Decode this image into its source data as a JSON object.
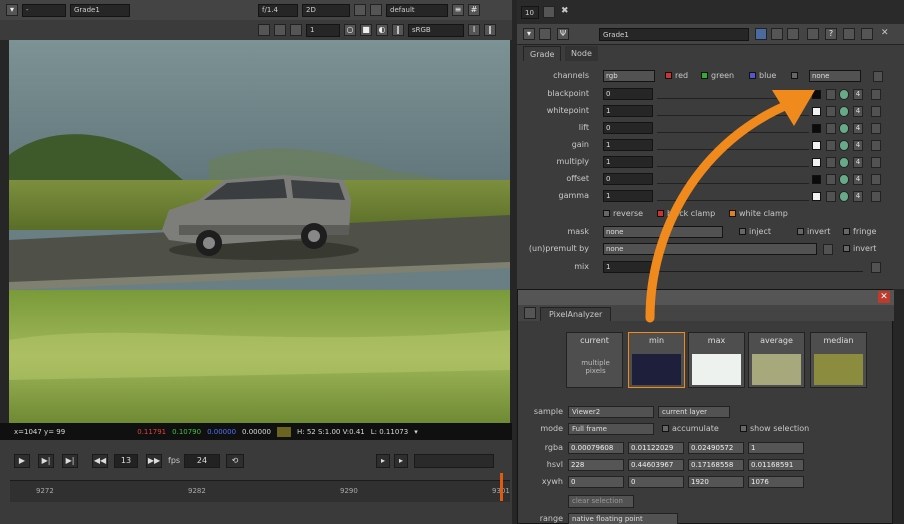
{
  "viewer": {
    "toolbar1": {
      "input_a": "-",
      "input_b": "Grade1",
      "gain": "f/1.4",
      "mode": "2D",
      "lut": "default"
    },
    "toolbar2": {
      "frame": "1",
      "proxy": "sRGB"
    },
    "infobar": {
      "coords": "x=1047 y= 99",
      "r": "0.11791",
      "g": "0.10790",
      "b": "0.00000",
      "a": "0.00000",
      "extra": "H: 52 S:1.00 V:0.41",
      "lum": "L: 0.11073"
    },
    "timeline": {
      "frame": "13",
      "fps_label": "fps",
      "fps": "24",
      "ticks": [
        "9272",
        "9282",
        "9290",
        "9301"
      ]
    }
  },
  "properties": {
    "node_name": "Grade1",
    "tabs": [
      "Grade",
      "Node"
    ],
    "channels": {
      "label": "channels",
      "value": "rgb",
      "red": "red",
      "green": "green",
      "blue": "blue",
      "none": "none"
    },
    "params": [
      {
        "label": "blackpoint",
        "value": "0",
        "swatch": "#0b0b0b"
      },
      {
        "label": "whitepoint",
        "value": "1",
        "swatch": "#f2f2f2"
      },
      {
        "label": "lift",
        "value": "0",
        "swatch": "#0b0b0b"
      },
      {
        "label": "gain",
        "value": "1",
        "swatch": "#f2f2f2"
      },
      {
        "label": "multiply",
        "value": "1",
        "swatch": "#f2f2f2"
      },
      {
        "label": "offset",
        "value": "0",
        "swatch": "#0b0b0b"
      },
      {
        "label": "gamma",
        "value": "1",
        "swatch": "#f2f2f2"
      }
    ],
    "clamp": {
      "reverse": "reverse",
      "black": "black clamp",
      "white": "white clamp"
    },
    "mask": {
      "label": "mask",
      "value": "none",
      "inject": "inject",
      "invert": "invert",
      "fringe": "fringe"
    },
    "unpremult": {
      "label": "(un)premult by",
      "value": "none",
      "invert": "invert"
    },
    "mix": {
      "label": "mix",
      "value": "1"
    }
  },
  "pixel_analyzer": {
    "tab": "PixelAnalyzer",
    "columns": [
      {
        "label": "current",
        "note": "multiple pixels",
        "color": ""
      },
      {
        "label": "min",
        "color": "#1e1f3a"
      },
      {
        "label": "max",
        "color": "#eef2ee"
      },
      {
        "label": "average",
        "color": "#a7a87c"
      },
      {
        "label": "median",
        "color": "#8b8c3e"
      }
    ],
    "sample": {
      "label": "sample",
      "value": "Viewer2",
      "layer": "current layer"
    },
    "mode": {
      "label": "mode",
      "value": "Full frame",
      "accumulate": "accumulate",
      "show_selection": "show selection"
    },
    "rgba": {
      "label": "rgba",
      "values": [
        "0.00079608",
        "0.01122029",
        "0.02490572",
        "1"
      ]
    },
    "hsvl": {
      "label": "hsvl",
      "values": [
        "228",
        "0.44603967",
        "0.17168558",
        "0.01168591"
      ]
    },
    "xywh": {
      "label": "xywh",
      "values": [
        "0",
        "0",
        "1920",
        "1076"
      ]
    },
    "clear_selection": "clear selection",
    "range": {
      "label": "range",
      "value": "native floating point"
    }
  },
  "accent": "#f18a1c"
}
